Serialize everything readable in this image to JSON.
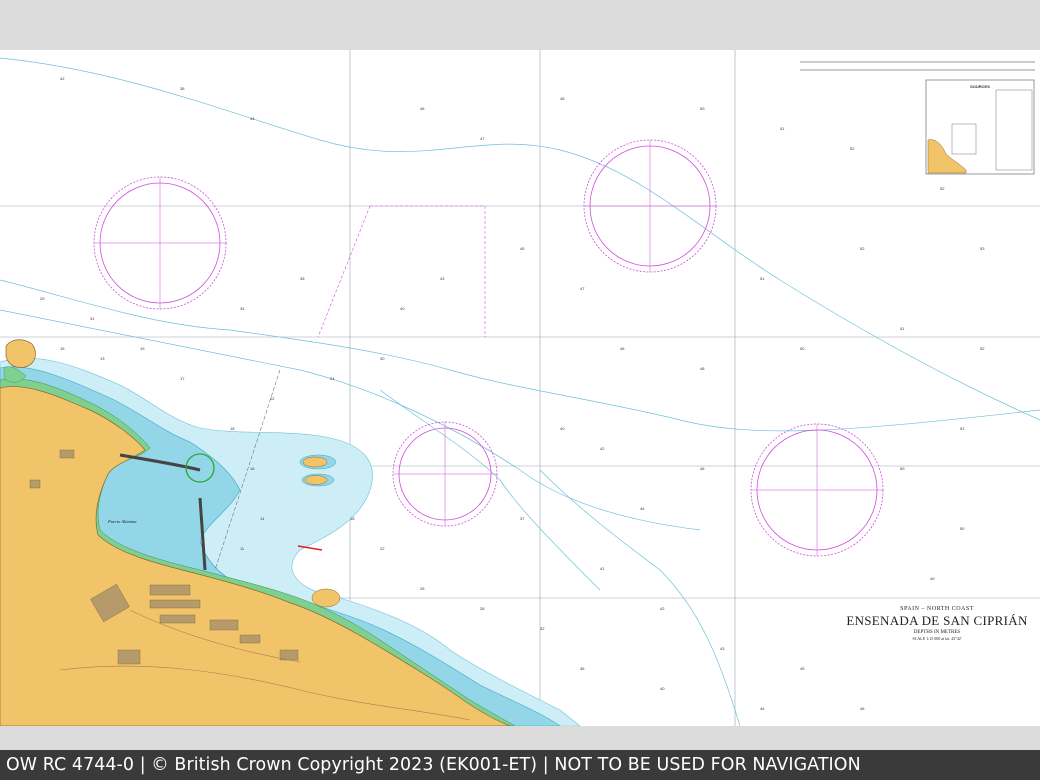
{
  "chart": {
    "region_label": "SPAIN – NORTH COAST",
    "title": "ENSENADA DE SAN CIPRIÁN",
    "depths_note": "DEPTHS IN METRES",
    "scale_note": "SCALE 1:15 000 at lat. 43°42'",
    "sources_title": "SOURCES",
    "colors": {
      "land": "#f2c46a",
      "intertidal": "#7fcf8e",
      "shallow_water": "#8fd4e6",
      "medium_water": "#c6ebf4",
      "compass_rose": "#d24ae0",
      "depth_contour": "#5ab4d2"
    }
  },
  "footer": {
    "text": "OW RC 4744-0 | © British Crown Copyright 2023 (EK001-ET) | NOT TO BE USED FOR NAVIGATION"
  }
}
